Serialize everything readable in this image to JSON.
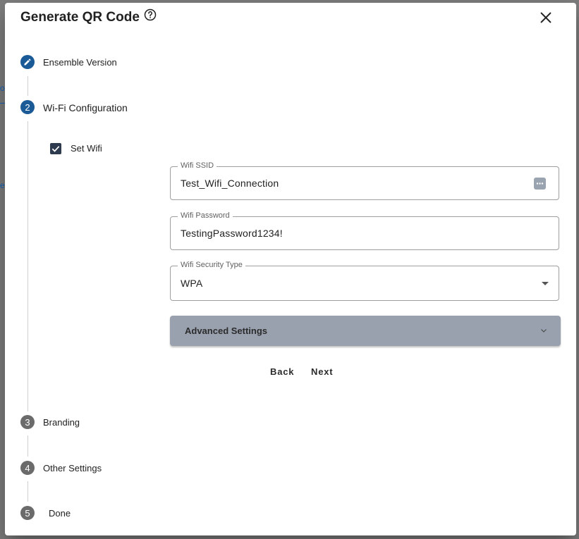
{
  "dialog": {
    "title": "Generate QR Code"
  },
  "steps": [
    {
      "number": "",
      "label": "Ensemble Version",
      "state": "edit"
    },
    {
      "number": "2",
      "label": "Wi-Fi Configuration",
      "state": "active"
    },
    {
      "number": "3",
      "label": "Branding",
      "state": "inactive"
    },
    {
      "number": "4",
      "label": "Other Settings",
      "state": "inactive"
    },
    {
      "number": "5",
      "label": "Done",
      "state": "inactive"
    }
  ],
  "wifi": {
    "set_wifi_label": "Set Wifi",
    "set_wifi_checked": true,
    "ssid": {
      "label": "Wifi SSID",
      "value": "Test_Wifi_Connection"
    },
    "password": {
      "label": "Wifi Password",
      "value": "TestingPassword1234!"
    },
    "security": {
      "label": "Wifi Security Type",
      "value": "WPA"
    },
    "advanced_label": "Advanced Settings"
  },
  "actions": {
    "back": "Back",
    "next": "Next"
  },
  "colors": {
    "active_step": "#1a5a97",
    "inactive_step": "#6b6b6b",
    "advanced_panel": "#99a1af",
    "checkbox": "#2e3b4e"
  }
}
